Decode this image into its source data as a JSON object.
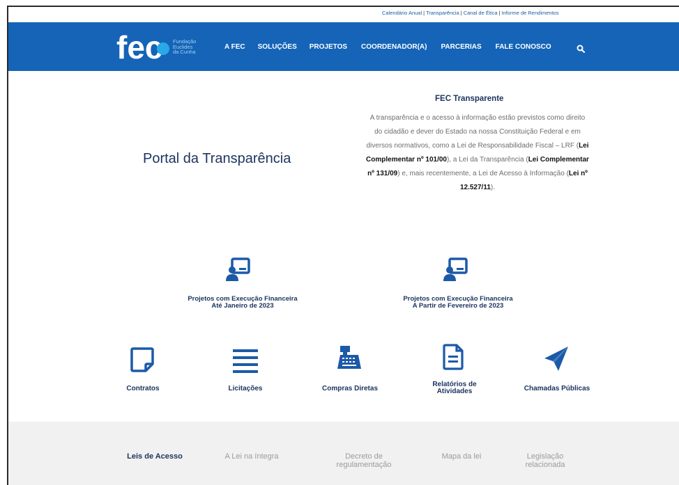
{
  "topbar": {
    "links": [
      "Calendário Anual",
      "Transparência",
      "Canal de Ética",
      "Informe de Rendimentos"
    ],
    "separator": "|"
  },
  "header": {
    "logo_text": "fec",
    "org_name_line1": "Fundação",
    "org_name_line2": "Euclides",
    "org_name_line3": "da Cunha",
    "nav": [
      "A FEC",
      "SOLUÇÕES",
      "PROJETOS",
      "COORDENADOR(A)",
      "PARCERIAS",
      "FALE CONOSCO"
    ],
    "search_icon": "search-icon"
  },
  "hero": {
    "title": "Portal da Transparência",
    "side_title": "FEC Transparente",
    "side_text_parts": [
      "A transparência e o acesso à informação estão previstos como direito do cidadão e dever do Estado na nossa Constituição Federal e em diversos normativos, como a Lei de Responsabilidade Fiscal – LRF (",
      "Lei Complementar nº 101/00",
      "), a Lei da Transparência (",
      "Lei Complementar nº 131/09",
      ") e, mais recentemente, a Lei de Acesso à Informação (",
      "Lei nº 12.527/11",
      ")."
    ]
  },
  "projects": [
    {
      "line1": "Projetos com Execução Financeira",
      "line2": "Até Janeiro de 2023",
      "icon": "teacher-board-icon"
    },
    {
      "line1": "Projetos com Execução Financeira",
      "line2": "A Partir de Fevereiro de 2023",
      "icon": "teacher-board-icon"
    }
  ],
  "categories": [
    {
      "label": "Contratos",
      "label2": "",
      "icon": "document-note-icon"
    },
    {
      "label": "Licitações",
      "label2": "",
      "icon": "list-icon"
    },
    {
      "label": "Compras Diretas",
      "label2": "",
      "icon": "cash-register-icon"
    },
    {
      "label": "Relatórios de",
      "label2": "Atividades",
      "icon": "file-report-icon"
    },
    {
      "label": "Chamadas Públicas",
      "label2": "",
      "icon": "paper-plane-icon"
    }
  ],
  "footer_tabs": [
    {
      "line1": "Leis de Acesso",
      "line2": ""
    },
    {
      "line1": "A Lei na íntegra",
      "line2": ""
    },
    {
      "line1": "Decreto de",
      "line2": "regulamentação"
    },
    {
      "line1": "Mapa da lei",
      "line2": ""
    },
    {
      "line1": "Legislação",
      "line2": "relacionada"
    }
  ],
  "colors": {
    "brand_blue": "#1564b7",
    "icon_blue": "#1c5aa8",
    "title_navy": "#1c3560"
  }
}
